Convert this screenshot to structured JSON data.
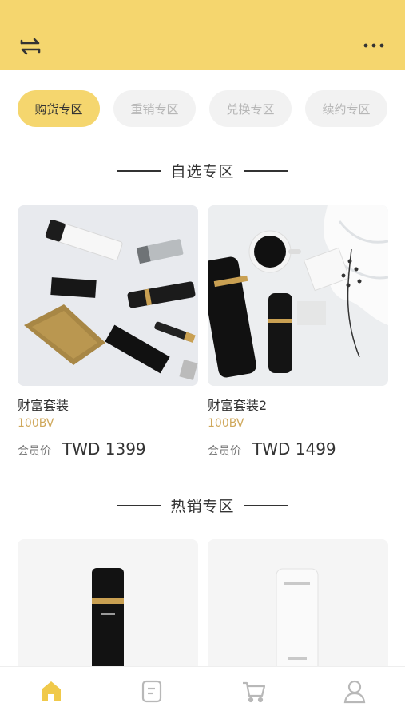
{
  "header": {
    "left_icon": "swap-icon",
    "right_icon": "more-icon",
    "bg_color": "#f5d66e"
  },
  "tabs": [
    {
      "label": "购货专区",
      "active": true
    },
    {
      "label": "重销专区",
      "active": false
    },
    {
      "label": "兑换专区",
      "active": false
    },
    {
      "label": "续约专区",
      "active": false
    }
  ],
  "sections": {
    "featured": {
      "title": "自选专区",
      "products": [
        {
          "name": "财富套装",
          "bv": "100BV",
          "price_label": "会员价",
          "price": "TWD 1399",
          "image": "cosmetics-flatlay"
        },
        {
          "name": "财富套装2",
          "bv": "100BV",
          "price_label": "会员价",
          "price": "TWD 1499",
          "image": "black-bottles-with-flowers"
        }
      ]
    },
    "hot": {
      "title": "热销专区",
      "products": [
        {
          "image": "black-serum-bottle"
        },
        {
          "image": "white-cleanser-tube"
        }
      ]
    }
  },
  "bottom_nav": [
    {
      "icon": "home-icon",
      "active": true
    },
    {
      "icon": "orders-icon",
      "active": false
    },
    {
      "icon": "cart-icon",
      "active": false
    },
    {
      "icon": "profile-icon",
      "active": false
    }
  ],
  "colors": {
    "accent": "#f5d66e",
    "bv": "#cfa85b",
    "nav_active": "#f0c94a",
    "nav_inactive": "#b8b8b8"
  }
}
